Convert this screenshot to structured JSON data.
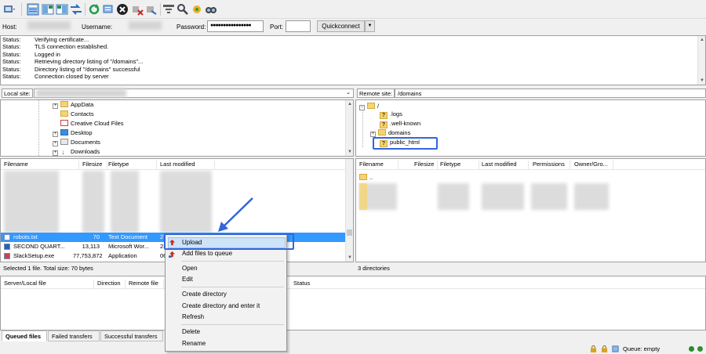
{
  "quickconnect": {
    "host_label": "Host:",
    "username_label": "Username:",
    "password_label": "Password:",
    "password_value": "●●●●●●●●●●●●●●●●",
    "port_label": "Port:",
    "connect_button": "Quickconnect",
    "dropdown_glyph": "▼"
  },
  "message_log": [
    {
      "key": "Status:",
      "text": "Verifying certificate..."
    },
    {
      "key": "Status:",
      "text": "TLS connection established."
    },
    {
      "key": "Status:",
      "text": "Logged in"
    },
    {
      "key": "Status:",
      "text": "Retrieving directory listing of \"/domains\"..."
    },
    {
      "key": "Status:",
      "text": "Directory listing of \"/domains\" successful"
    },
    {
      "key": "Status:",
      "text": "Connection closed by server"
    }
  ],
  "local": {
    "site_label": "Local site:",
    "tree": [
      "AppData",
      "Contacts",
      "Creative Cloud Files",
      "Desktop",
      "Documents",
      "Downloads"
    ],
    "columns": [
      "Filename",
      "Filesize",
      "Filetype",
      "Last modified"
    ],
    "files": [
      {
        "name": "robots.txt",
        "size": "70",
        "type": "Text Document",
        "modified": "27"
      },
      {
        "name": "SECOND QUART...",
        "size": "13,113",
        "type": "Microsoft Wor...",
        "modified": "23"
      },
      {
        "name": "SlackSetup.exe",
        "size": "77,753,872",
        "type": "Application",
        "modified": "06"
      }
    ],
    "status": "Selected 1 file. Total size: 70 bytes"
  },
  "remote": {
    "site_label": "Remote site:",
    "site_path": "/domains",
    "tree_root": "/",
    "tree": [
      ".logs",
      ".well-known",
      "domains",
      "public_html"
    ],
    "columns": [
      "Filename",
      "Filesize",
      "Filetype",
      "Last modified",
      "Permissions",
      "Owner/Gro..."
    ],
    "parent_row": "..",
    "status": "3 directories"
  },
  "queue": {
    "columns": [
      "Server/Local file",
      "Direction",
      "Remote file",
      "Status"
    ],
    "tabs": [
      "Queued files",
      "Failed transfers",
      "Successful transfers"
    ],
    "queue_status": "Queue: empty"
  },
  "context_menu": {
    "items": [
      "Upload",
      "Add files to queue",
      "Open",
      "Edit",
      "Create directory",
      "Create directory and enter it",
      "Refresh",
      "Delete",
      "Rename"
    ]
  },
  "colors": {
    "selection": "#3399ff",
    "highlight_box": "#3366dd",
    "arrow": "#3366dd"
  }
}
